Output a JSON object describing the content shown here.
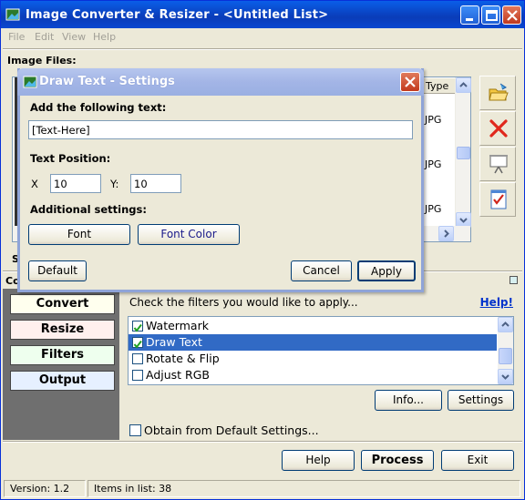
{
  "window": {
    "title": "Image Converter & Resizer - <Untitled List>",
    "menu": [
      "File",
      "Edit",
      "View",
      "Help"
    ]
  },
  "files_section": {
    "label": "Image Files:",
    "column_type": "Type",
    "type_values": [
      "JPG",
      "JPG",
      "JPG"
    ],
    "hidden_label_s": "S",
    "hidden_label_co": "Co"
  },
  "sidebar": {
    "buttons": [
      {
        "label": "Convert",
        "color": "#ffffee"
      },
      {
        "label": "Resize",
        "color": "#fff0ee"
      },
      {
        "label": "Filters",
        "color": "#eeffee"
      },
      {
        "label": "Output",
        "color": "#e6f0ff"
      }
    ]
  },
  "filters": {
    "caption": "Check the filters you would like to apply...",
    "help": "Help!",
    "items": [
      {
        "label": "Watermark",
        "checked": true,
        "selected": false
      },
      {
        "label": "Draw Text",
        "checked": true,
        "selected": true
      },
      {
        "label": "Rotate & Flip",
        "checked": false,
        "selected": false
      },
      {
        "label": "Adjust RGB",
        "checked": false,
        "selected": false
      }
    ],
    "info_button": "Info...",
    "settings_button": "Settings",
    "default_checkbox": "Obtain from Default Settings..."
  },
  "bottom_buttons": {
    "help": "Help",
    "process": "Process",
    "exit": "Exit"
  },
  "status": {
    "version": "Version: 1.2",
    "items": "Items in list: 38"
  },
  "dialog": {
    "title": "Draw Text - Settings",
    "add_text_label": "Add the following text:",
    "text_value": "[Text-Here]",
    "position_label": "Text Position:",
    "x_label": "X",
    "x_value": "10",
    "y_label": "Y:",
    "y_value": "10",
    "additional_label": "Additional settings:",
    "font_button": "Font",
    "font_color_button": "Font Color",
    "default_button": "Default",
    "cancel_button": "Cancel",
    "apply_button": "Apply"
  }
}
